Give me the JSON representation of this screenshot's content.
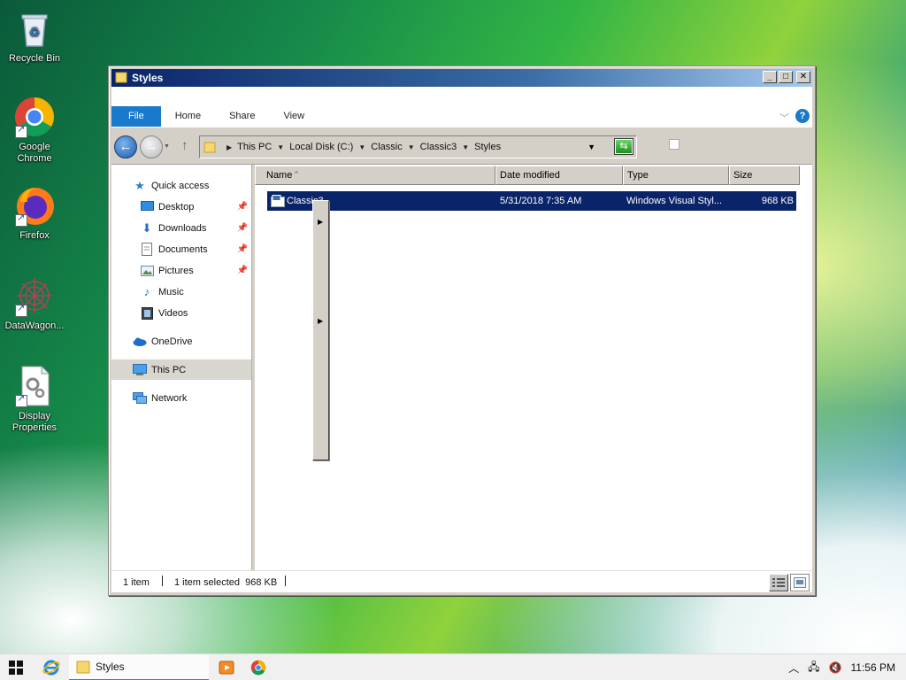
{
  "desktop": {
    "icons": [
      {
        "label": "Recycle Bin",
        "icon": "recycle-bin-icon"
      },
      {
        "label": "Google Chrome",
        "icon": "chrome-icon"
      },
      {
        "label": "Firefox",
        "icon": "firefox-icon"
      },
      {
        "label": "DataWagon...",
        "icon": "datawagon-icon"
      },
      {
        "label": "Display Properties",
        "icon": "display-properties-icon"
      }
    ]
  },
  "window": {
    "title": "Styles",
    "buttons": {
      "minimize": "_",
      "maximize": "□",
      "close": "✕"
    },
    "ribbon": {
      "tabs": [
        "File",
        "Home",
        "Share",
        "View"
      ],
      "help": "?"
    },
    "address": {
      "crumbs": [
        "This PC",
        "Local Disk (C:)",
        "Classic",
        "Classic3",
        "Styles"
      ]
    },
    "nav": {
      "items": [
        {
          "label": "Quick access",
          "icon": "star-icon",
          "pinned": false
        },
        {
          "label": "Desktop",
          "icon": "desktop-icon",
          "pinned": true
        },
        {
          "label": "Downloads",
          "icon": "download-icon",
          "pinned": true
        },
        {
          "label": "Documents",
          "icon": "documents-icon",
          "pinned": true
        },
        {
          "label": "Pictures",
          "icon": "pictures-icon",
          "pinned": true
        },
        {
          "label": "Music",
          "icon": "music-icon",
          "pinned": false
        },
        {
          "label": "Videos",
          "icon": "videos-icon",
          "pinned": false
        },
        {
          "label": "OneDrive",
          "icon": "cloud-icon",
          "pinned": false
        },
        {
          "label": "This PC",
          "icon": "computer-icon",
          "pinned": false,
          "selected": true
        },
        {
          "label": "Network",
          "icon": "network-icon",
          "pinned": false
        }
      ]
    },
    "columns": [
      "Name",
      "Date modified",
      "Type",
      "Size"
    ],
    "files": [
      {
        "name": "Classic3",
        "date_modified": "5/31/2018 7:35 AM",
        "type": "Windows Visual Styl...",
        "size": "968 KB",
        "selected": true
      }
    ],
    "status": {
      "item_count": "1 item",
      "selection": "1 item selected  968 KB"
    }
  },
  "taskbar": {
    "open_window_label": "Styles",
    "clock": "11:56 PM"
  }
}
